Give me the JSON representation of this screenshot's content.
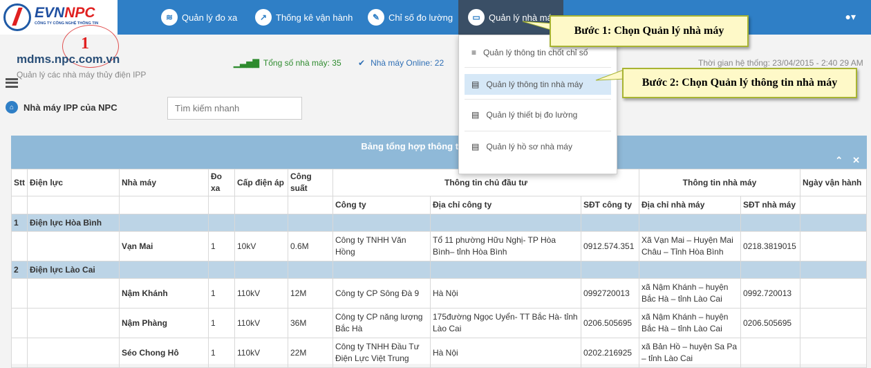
{
  "logo": {
    "brand": "EVN",
    "brand_accent": "NPC",
    "sub": "CÔNG TY CÔNG NGHỆ THÔNG TIN"
  },
  "nav": {
    "items": [
      {
        "label": "Quản lý đo xa",
        "icon": "wifi-icon"
      },
      {
        "label": "Thống kê vận hành",
        "icon": "chart-icon"
      },
      {
        "label": "Chỉ số đo lường",
        "icon": "edit-icon"
      },
      {
        "label": "Quản lý nhà máy",
        "icon": "folder-icon"
      }
    ]
  },
  "site": {
    "domain": "mdms.npc.com.vn",
    "subtitle": "Quản lý các nhà máy thủy điện IPP"
  },
  "stats": {
    "total_label": "Tổng số nhà máy: 35",
    "online_label": "Nhà máy Online: 22"
  },
  "system_time": "Thời gian hệ thống: 23/04/2015 - 2:40 29 AM",
  "breadcrumb": "Nhà máy IPP của NPC",
  "search": {
    "placeholder": "Tìm kiếm nhanh"
  },
  "panel": {
    "title": "Bảng tổng hợp thông tin Chủ đầu tư"
  },
  "table": {
    "headers": {
      "stt": "Stt",
      "dien_luc": "Điện lực",
      "nha_may": "Nhà máy",
      "do_xa": "Đo xa",
      "cap_dien_ap": "Cấp điện áp",
      "cong_suat": "Công suất",
      "chu_dau_tu": "Thông tin chủ đầu tư",
      "thong_tin_nha_may": "Thông tin nhà máy",
      "ngay_van_hanh": "Ngày vận hành",
      "cong_ty": "Công ty",
      "dia_chi_cong_ty": "Địa chỉ công ty",
      "sdt_cong_ty": "SĐT công ty",
      "dia_chi_nha_may": "Địa chỉ nhà máy",
      "sdt_nha_may": "SĐT nhà máy"
    },
    "groups": [
      {
        "stt": "1",
        "name": "Điện lực Hòa Bình",
        "rows": [
          {
            "nha_may": "Vạn Mai",
            "do_xa": "1",
            "cap": "10kV",
            "cs": "0.6M",
            "cong_ty": "Công ty TNHH Văn Hồng",
            "dc_cty": "Tổ 11 phường Hữu Nghị- TP Hòa Bình– tỉnh Hòa Bình",
            "sdt_cty": "0912.574.351",
            "dc_nm": "Xã Vạn Mai – Huyện Mai Châu – Tỉnh Hòa Bình",
            "sdt_nm": "0218.3819015"
          }
        ]
      },
      {
        "stt": "2",
        "name": "Điện lực Lào Cai",
        "rows": [
          {
            "nha_may": "Nậm Khánh",
            "do_xa": "1",
            "cap": "110kV",
            "cs": "12M",
            "cong_ty": "Công ty CP Sông Đà 9",
            "dc_cty": "Hà Nội",
            "sdt_cty": "0992720013",
            "dc_nm": "xã Nậm Khánh – huyện Bắc Hà – tỉnh Lào Cai",
            "sdt_nm": "0992.720013"
          },
          {
            "nha_may": "Nậm Phàng",
            "do_xa": "1",
            "cap": "110kV",
            "cs": "36M",
            "cong_ty": "Công ty CP năng lượng Bắc Hà",
            "dc_cty": "175đường Ngọc Uyển- TT Bắc Hà- tỉnh Lào Cai",
            "sdt_cty": "0206.505695",
            "dc_nm": "xã Nậm Khánh – huyện Bắc Hà – tỉnh Lào Cai",
            "sdt_nm": "0206.505695"
          },
          {
            "nha_may": "Séo Chong Hô",
            "do_xa": "1",
            "cap": "110kV",
            "cs": "22M",
            "cong_ty": "Công ty TNHH Đầu Tư Điện Lực Việt Trung",
            "dc_cty": "Hà Nội",
            "sdt_cty": "0202.216925",
            "dc_nm": "xã Bản Hồ – huyện Sa Pa – tỉnh Lào Cai",
            "sdt_nm": ""
          }
        ]
      }
    ]
  },
  "dropdown": {
    "items": [
      {
        "label": "Quản lý thông tin chốt chỉ số",
        "icon": "database-icon"
      },
      {
        "label": "Quản lý thông tin nhà máy",
        "icon": "document-icon"
      },
      {
        "label": "Quản lý thiết bị đo lường",
        "icon": "document-icon"
      },
      {
        "label": "Quản lý hồ sơ nhà máy",
        "icon": "document-icon"
      }
    ]
  },
  "callouts": {
    "step1": "Bước 1: Chọn Quản lý nhà máy",
    "step2": "Bước 2: Chọn Quản lý thông tin nhà máy",
    "marker": "1"
  },
  "colors": {
    "topbar": "#2f7fc6",
    "group_row": "#bcd4e6",
    "callout_bg": "#fef9c8",
    "accent_red": "#e02020"
  }
}
